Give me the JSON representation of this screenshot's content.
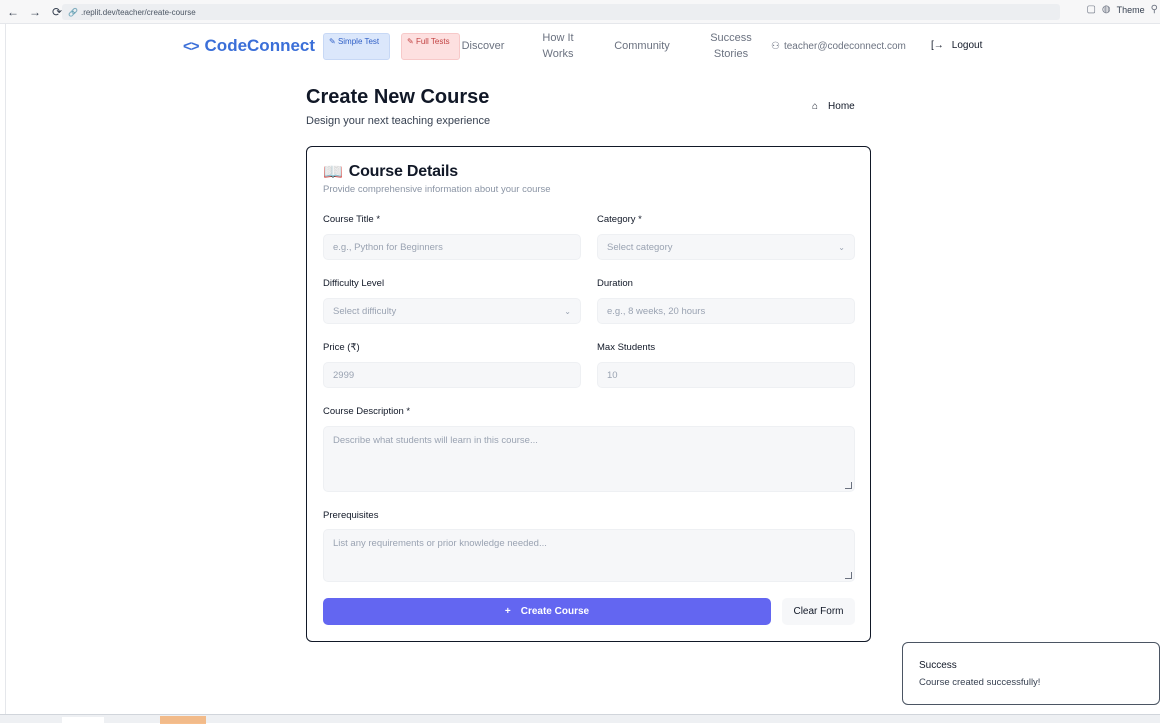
{
  "browser": {
    "url": ".replit.dev/teacher/create-course",
    "theme_label": "Theme"
  },
  "nav": {
    "logo_text": "CodeConnect",
    "pill_simple": "Simple Test",
    "pill_full": "Full Tests",
    "discover": "Discover",
    "how_it_works": "How It Works",
    "community": "Community",
    "success_stories": "Success Stories",
    "user_email": "teacher@codeconnect.com",
    "logout": "Logout"
  },
  "header": {
    "title": "Create New Course",
    "subtitle": "Design your next teaching experience",
    "home": "Home"
  },
  "card": {
    "title": "Course Details",
    "subtitle": "Provide comprehensive information about your course",
    "fields": {
      "course_title_label": "Course Title *",
      "course_title_placeholder": "e.g., Python for Beginners",
      "category_label": "Category *",
      "category_placeholder": "Select category",
      "difficulty_label": "Difficulty Level",
      "difficulty_placeholder": "Select difficulty",
      "duration_label": "Duration",
      "duration_placeholder": "e.g., 8 weeks, 20 hours",
      "price_label": "Price (₹)",
      "price_placeholder": "2999",
      "max_students_label": "Max Students",
      "max_students_placeholder": "10",
      "description_label": "Course Description *",
      "description_placeholder": "Describe what students will learn in this course...",
      "prerequisites_label": "Prerequisites",
      "prerequisites_placeholder": "List any requirements or prior knowledge needed..."
    },
    "create_button": "Create Course",
    "clear_button": "Clear Form"
  },
  "toast": {
    "title": "Success",
    "message": "Course created successfully!"
  },
  "colors": {
    "brand": "#3b6fd8",
    "primary_button": "#6366f1"
  }
}
